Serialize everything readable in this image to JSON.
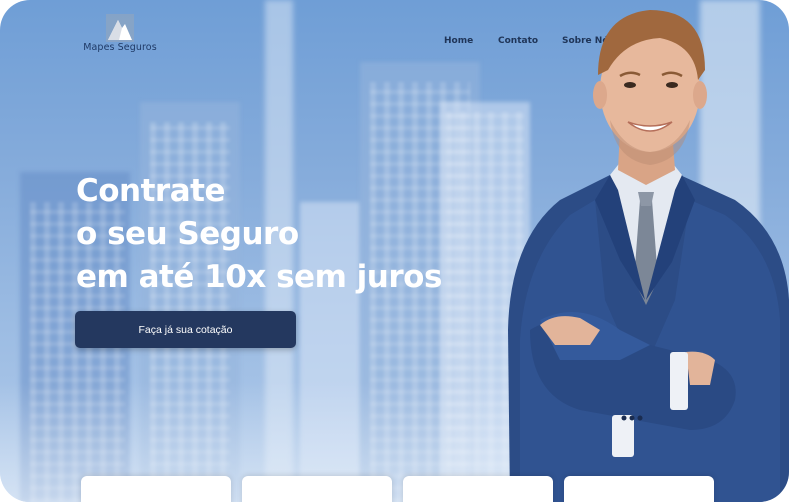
{
  "header": {
    "logo_text": "Mapes Seguros",
    "logo_icon": "mountain-logo-icon"
  },
  "nav": {
    "items": [
      {
        "label": "Home"
      },
      {
        "label": "Contato"
      },
      {
        "label": "Sobre Nós"
      }
    ]
  },
  "hero": {
    "headline_lines": [
      "Contrate",
      "o seu Seguro",
      "em até 10x sem juros"
    ],
    "cta_label": "Faça já sua cotação"
  },
  "cards": [
    {},
    {},
    {},
    {}
  ],
  "colors": {
    "brand_navy": "#24385f",
    "nav_text": "#1f3558",
    "hero_text": "#ffffff",
    "background_blue": "#86acdb"
  }
}
